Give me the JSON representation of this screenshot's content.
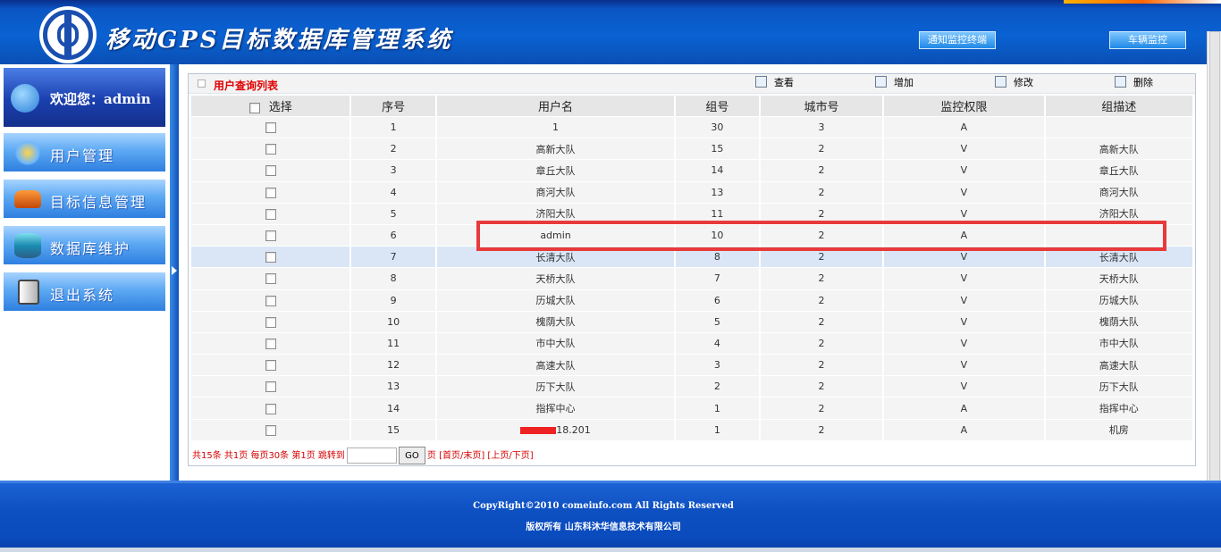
{
  "header": {
    "title": "移动GPS目标数据库管理系统",
    "buttons": [
      "通知监控终端",
      "车辆监控"
    ]
  },
  "sidebar": {
    "welcome": "欢迎您：admin",
    "items": [
      {
        "label": "用户管理",
        "icon": "users-icon"
      },
      {
        "label": "目标信息管理",
        "icon": "car-icon"
      },
      {
        "label": "数据库维护",
        "icon": "database-icon"
      },
      {
        "label": "退出系统",
        "icon": "exit-icon"
      }
    ]
  },
  "panel": {
    "title": "用户查询列表",
    "toolbar": {
      "view": "查看",
      "add": "增加",
      "edit": "修改",
      "delete": "删除"
    },
    "columns": [
      "选择",
      "序号",
      "用户名",
      "组号",
      "城市号",
      "监控权限",
      "组描述"
    ],
    "rows": [
      {
        "no": "1",
        "name": "1",
        "group": "30",
        "city": "3",
        "perm": "A",
        "desc": ""
      },
      {
        "no": "2",
        "name": "高新大队",
        "group": "15",
        "city": "2",
        "perm": "V",
        "desc": "高新大队"
      },
      {
        "no": "3",
        "name": "章丘大队",
        "group": "14",
        "city": "2",
        "perm": "V",
        "desc": "章丘大队"
      },
      {
        "no": "4",
        "name": "商河大队",
        "group": "13",
        "city": "2",
        "perm": "V",
        "desc": "商河大队"
      },
      {
        "no": "5",
        "name": "济阳大队",
        "group": "11",
        "city": "2",
        "perm": "V",
        "desc": "济阳大队"
      },
      {
        "no": "6",
        "name": "admin",
        "group": "10",
        "city": "2",
        "perm": "A",
        "desc": ""
      },
      {
        "no": "7",
        "name": "长清大队",
        "group": "8",
        "city": "2",
        "perm": "V",
        "desc": "长清大队"
      },
      {
        "no": "8",
        "name": "天桥大队",
        "group": "7",
        "city": "2",
        "perm": "V",
        "desc": "天桥大队"
      },
      {
        "no": "9",
        "name": "历城大队",
        "group": "6",
        "city": "2",
        "perm": "V",
        "desc": "历城大队"
      },
      {
        "no": "10",
        "name": "槐荫大队",
        "group": "5",
        "city": "2",
        "perm": "V",
        "desc": "槐荫大队"
      },
      {
        "no": "11",
        "name": "市中大队",
        "group": "4",
        "city": "2",
        "perm": "V",
        "desc": "市中大队"
      },
      {
        "no": "12",
        "name": "高速大队",
        "group": "3",
        "city": "2",
        "perm": "V",
        "desc": "高速大队"
      },
      {
        "no": "13",
        "name": "历下大队",
        "group": "2",
        "city": "2",
        "perm": "V",
        "desc": "历下大队"
      },
      {
        "no": "14",
        "name": "指挥中心",
        "group": "1",
        "city": "2",
        "perm": "A",
        "desc": "指挥中心"
      },
      {
        "no": "15",
        "name": "18.201",
        "group": "1",
        "city": "2",
        "perm": "A",
        "desc": "机房",
        "redacted": true
      }
    ],
    "pager": {
      "summary": "共15条 共1页 每页30条 第1页  跳转到",
      "jump_value": "",
      "go_label": "GO",
      "links": "页 [首页/末页] [上页/下页]"
    }
  },
  "footer": {
    "copyright": "CopyRight©2010 comeinfo.com All Rights Reserved",
    "owner": "版权所有   山东科沐华信息技术有限公司"
  },
  "colors": {
    "accent": "#0a4fb4",
    "highlight_row": "#dae6f5",
    "annotation": "#e83a3a",
    "title_red": "#e00000"
  }
}
